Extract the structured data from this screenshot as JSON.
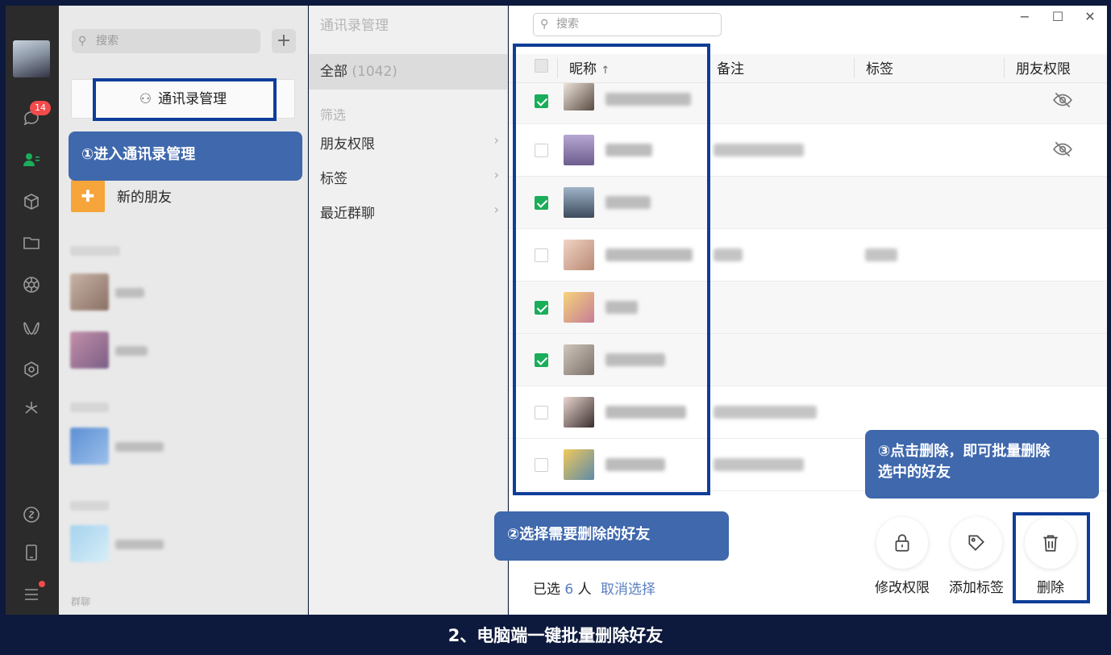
{
  "sidebar": {
    "chat_badge": "14"
  },
  "contact_list": {
    "search_placeholder": "搜索",
    "add_symbol": "+",
    "manage_button": "通讯录管理",
    "new_friends": "新的朋友",
    "group_section": "群聊"
  },
  "filter_panel": {
    "title": "通讯录管理",
    "all_label": "全部",
    "all_count": "(1042)",
    "filter_heading": "筛选",
    "items": [
      {
        "label": "朋友权限"
      },
      {
        "label": "标签"
      },
      {
        "label": "最近群聊"
      }
    ]
  },
  "main": {
    "search_placeholder": "搜索",
    "window_controls": {
      "minimize": "−",
      "maximize": "☐",
      "close": "✕"
    },
    "columns": {
      "nickname": "昵称",
      "sort_arrow": "↑",
      "remark": "备注",
      "tags": "标签",
      "permission": "朋友权限"
    },
    "rows": [
      {
        "checked": true,
        "permission_icon": "eye-hidden-icon"
      },
      {
        "checked": false,
        "permission_icon": "eye-hidden-icon"
      },
      {
        "checked": true,
        "permission_icon": ""
      },
      {
        "checked": false,
        "permission_icon": ""
      },
      {
        "checked": true,
        "permission_icon": ""
      },
      {
        "checked": true,
        "permission_icon": ""
      },
      {
        "checked": false,
        "permission_icon": ""
      },
      {
        "checked": false,
        "permission_icon": ""
      }
    ],
    "footer": {
      "selected_prefix": "已选",
      "selected_count": "6",
      "selected_unit": "人",
      "cancel_selection": "取消选择"
    },
    "actions": [
      {
        "label": "修改权限",
        "icon": "lock-icon"
      },
      {
        "label": "添加标签",
        "icon": "tag-icon"
      },
      {
        "label": "删除",
        "icon": "trash-icon"
      }
    ]
  },
  "annotations": {
    "step1": "①进入通讯录管理",
    "step2": "②选择需要删除的好友",
    "step3_line1": "③点击删除，即可批量删除",
    "step3_line2": "选中的好友",
    "caption": "2、电脑端一键批量删除好友"
  },
  "colors": {
    "accent_green": "#1aad5a",
    "highlight_blue": "#0f3d99",
    "callout_blue": "#3f68ad",
    "link_blue": "#5a7fc0",
    "background_navy": "#0d1a3d"
  }
}
